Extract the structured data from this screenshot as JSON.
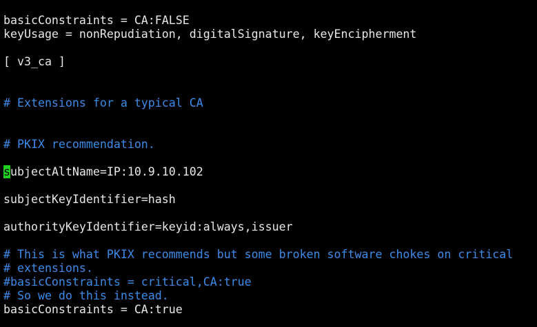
{
  "editor": {
    "lines": [
      {
        "kind": "code",
        "text": "basicConstraints = CA:FALSE"
      },
      {
        "kind": "code",
        "text": "keyUsage = nonRepudiation, digitalSignature, keyEncipherment"
      },
      {
        "kind": "blank",
        "text": ""
      },
      {
        "kind": "code",
        "text": "[ v3_ca ]"
      },
      {
        "kind": "blank",
        "text": ""
      },
      {
        "kind": "blank",
        "text": ""
      },
      {
        "kind": "comment",
        "text": "# Extensions for a typical CA"
      },
      {
        "kind": "blank",
        "text": ""
      },
      {
        "kind": "blank",
        "text": ""
      },
      {
        "kind": "comment",
        "text": "# PKIX recommendation."
      },
      {
        "kind": "blank",
        "text": ""
      },
      {
        "kind": "cursor",
        "cursor_char": "s",
        "text": "ubjectAltName=IP:10.9.10.102"
      },
      {
        "kind": "blank",
        "text": ""
      },
      {
        "kind": "code",
        "text": "subjectKeyIdentifier=hash"
      },
      {
        "kind": "blank",
        "text": ""
      },
      {
        "kind": "code",
        "text": "authorityKeyIdentifier=keyid:always,issuer"
      },
      {
        "kind": "blank",
        "text": ""
      },
      {
        "kind": "comment",
        "text": "# This is what PKIX recommends but some broken software chokes on critical"
      },
      {
        "kind": "comment",
        "text": "# extensions."
      },
      {
        "kind": "comment",
        "text": "#basicConstraints = critical,CA:true"
      },
      {
        "kind": "comment",
        "text": "# So we do this instead."
      },
      {
        "kind": "code",
        "text": "basicConstraints = CA:true"
      }
    ]
  },
  "colors": {
    "background": "#000000",
    "text": "#e8e8e8",
    "comment": "#3d8be8",
    "cursor": "#20d020"
  }
}
